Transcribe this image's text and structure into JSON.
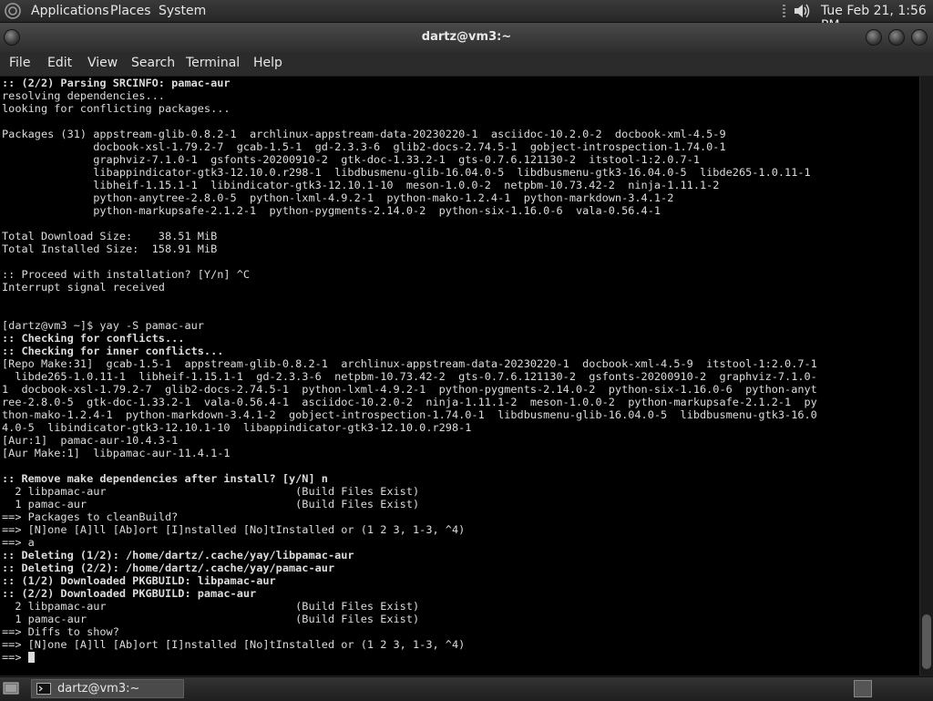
{
  "top_panel": {
    "menus": [
      "Applications",
      "Places",
      "System"
    ],
    "clock": "Tue Feb 21,  1:56 PM"
  },
  "window": {
    "title": "dartz@vm3:~",
    "menu": [
      "File",
      "Edit",
      "View",
      "Search",
      "Terminal",
      "Help"
    ]
  },
  "terminal": {
    "lines": [
      {
        "text": ":: (2/2) Parsing SRCINFO: pamac-aur",
        "bold": true
      },
      {
        "text": "resolving dependencies...",
        "bold": false
      },
      {
        "text": "looking for conflicting packages...",
        "bold": false
      },
      {
        "text": "",
        "bold": false
      },
      {
        "text": "Packages (31) appstream-glib-0.8.2-1  archlinux-appstream-data-20230220-1  asciidoc-10.2.0-2  docbook-xml-4.5-9",
        "bold": false
      },
      {
        "text": "              docbook-xsl-1.79.2-7  gcab-1.5-1  gd-2.3.3-6  glib2-docs-2.74.5-1  gobject-introspection-1.74.0-1",
        "bold": false
      },
      {
        "text": "              graphviz-7.1.0-1  gsfonts-20200910-2  gtk-doc-1.33.2-1  gts-0.7.6.121130-2  itstool-1:2.0.7-1",
        "bold": false
      },
      {
        "text": "              libappindicator-gtk3-12.10.0.r298-1  libdbusmenu-glib-16.04.0-5  libdbusmenu-gtk3-16.04.0-5  libde265-1.0.11-1",
        "bold": false
      },
      {
        "text": "              libheif-1.15.1-1  libindicator-gtk3-12.10.1-10  meson-1.0.0-2  netpbm-10.73.42-2  ninja-1.11.1-2",
        "bold": false
      },
      {
        "text": "              python-anytree-2.8.0-5  python-lxml-4.9.2-1  python-mako-1.2.4-1  python-markdown-3.4.1-2",
        "bold": false
      },
      {
        "text": "              python-markupsafe-2.1.2-1  python-pygments-2.14.0-2  python-six-1.16.0-6  vala-0.56.4-1",
        "bold": false
      },
      {
        "text": "",
        "bold": false
      },
      {
        "text": "Total Download Size:    38.51 MiB",
        "bold": false
      },
      {
        "text": "Total Installed Size:  158.91 MiB",
        "bold": false
      },
      {
        "text": "",
        "bold": false
      },
      {
        "text": ":: Proceed with installation? [Y/n] ^C",
        "bold": false
      },
      {
        "text": "Interrupt signal received",
        "bold": false
      },
      {
        "text": "",
        "bold": false
      },
      {
        "text": "",
        "bold": false
      },
      {
        "text": "[dartz@vm3 ~]$ yay -S pamac-aur",
        "bold": false
      },
      {
        "text": ":: Checking for conflicts...",
        "bold": true
      },
      {
        "text": ":: Checking for inner conflicts...",
        "bold": true
      },
      {
        "text": "[Repo Make:31]  gcab-1.5-1  appstream-glib-0.8.2-1  archlinux-appstream-data-20230220-1  docbook-xml-4.5-9  itstool-1:2.0.7-1",
        "bold": false
      },
      {
        "text": "  libde265-1.0.11-1  libheif-1.15.1-1  gd-2.3.3-6  netpbm-10.73.42-2  gts-0.7.6.121130-2  gsfonts-20200910-2  graphviz-7.1.0-",
        "bold": false
      },
      {
        "text": "1  docbook-xsl-1.79.2-7  glib2-docs-2.74.5-1  python-lxml-4.9.2-1  python-pygments-2.14.0-2  python-six-1.16.0-6  python-anyt",
        "bold": false
      },
      {
        "text": "ree-2.8.0-5  gtk-doc-1.33.2-1  vala-0.56.4-1  asciidoc-10.2.0-2  ninja-1.11.1-2  meson-1.0.0-2  python-markupsafe-2.1.2-1  py",
        "bold": false
      },
      {
        "text": "thon-mako-1.2.4-1  python-markdown-3.4.1-2  gobject-introspection-1.74.0-1  libdbusmenu-glib-16.04.0-5  libdbusmenu-gtk3-16.0",
        "bold": false
      },
      {
        "text": "4.0-5  libindicator-gtk3-12.10.1-10  libappindicator-gtk3-12.10.0.r298-1",
        "bold": false
      },
      {
        "text": "[Aur:1]  pamac-aur-10.4.3-1",
        "bold": false
      },
      {
        "text": "[Aur Make:1]  libpamac-aur-11.4.1-1",
        "bold": false
      },
      {
        "text": "",
        "bold": false
      },
      {
        "text": ":: Remove make dependencies after install? [y/N] n",
        "bold": true
      },
      {
        "text": "  2 libpamac-aur                             (Build Files Exist)",
        "bold": false
      },
      {
        "text": "  1 pamac-aur                                (Build Files Exist)",
        "bold": false
      },
      {
        "text": "==> Packages to cleanBuild?",
        "bold": false
      },
      {
        "text": "==> [N]one [A]ll [Ab]ort [I]nstalled [No]tInstalled or (1 2 3, 1-3, ^4)",
        "bold": false
      },
      {
        "text": "==> a",
        "bold": false
      },
      {
        "text": ":: Deleting (1/2): /home/dartz/.cache/yay/libpamac-aur",
        "bold": true
      },
      {
        "text": ":: Deleting (2/2): /home/dartz/.cache/yay/pamac-aur",
        "bold": true
      },
      {
        "text": ":: (1/2) Downloaded PKGBUILD: libpamac-aur",
        "bold": true
      },
      {
        "text": ":: (2/2) Downloaded PKGBUILD: pamac-aur",
        "bold": true
      },
      {
        "text": "  2 libpamac-aur                             (Build Files Exist)",
        "bold": false
      },
      {
        "text": "  1 pamac-aur                                (Build Files Exist)",
        "bold": false
      },
      {
        "text": "==> Diffs to show?",
        "bold": false
      },
      {
        "text": "==> [N]one [A]ll [Ab]ort [I]nstalled [No]tInstalled or (1 2 3, 1-3, ^4)",
        "bold": false
      },
      {
        "text": "==> ",
        "bold": false
      }
    ]
  },
  "taskbar": {
    "task_label": "dartz@vm3:~"
  },
  "icons": {
    "menu_logo": "gnome-foot-icon",
    "volume": "volume-speaker-icon",
    "show_desktop": "show-desktop-icon",
    "terminal_task": "terminal-icon",
    "workspace": "workspace-switcher-icon"
  },
  "colors": {
    "terminal_bg": "#000000",
    "terminal_fg": "#dcdcdc",
    "panel_bg": "#2b2b2b"
  }
}
